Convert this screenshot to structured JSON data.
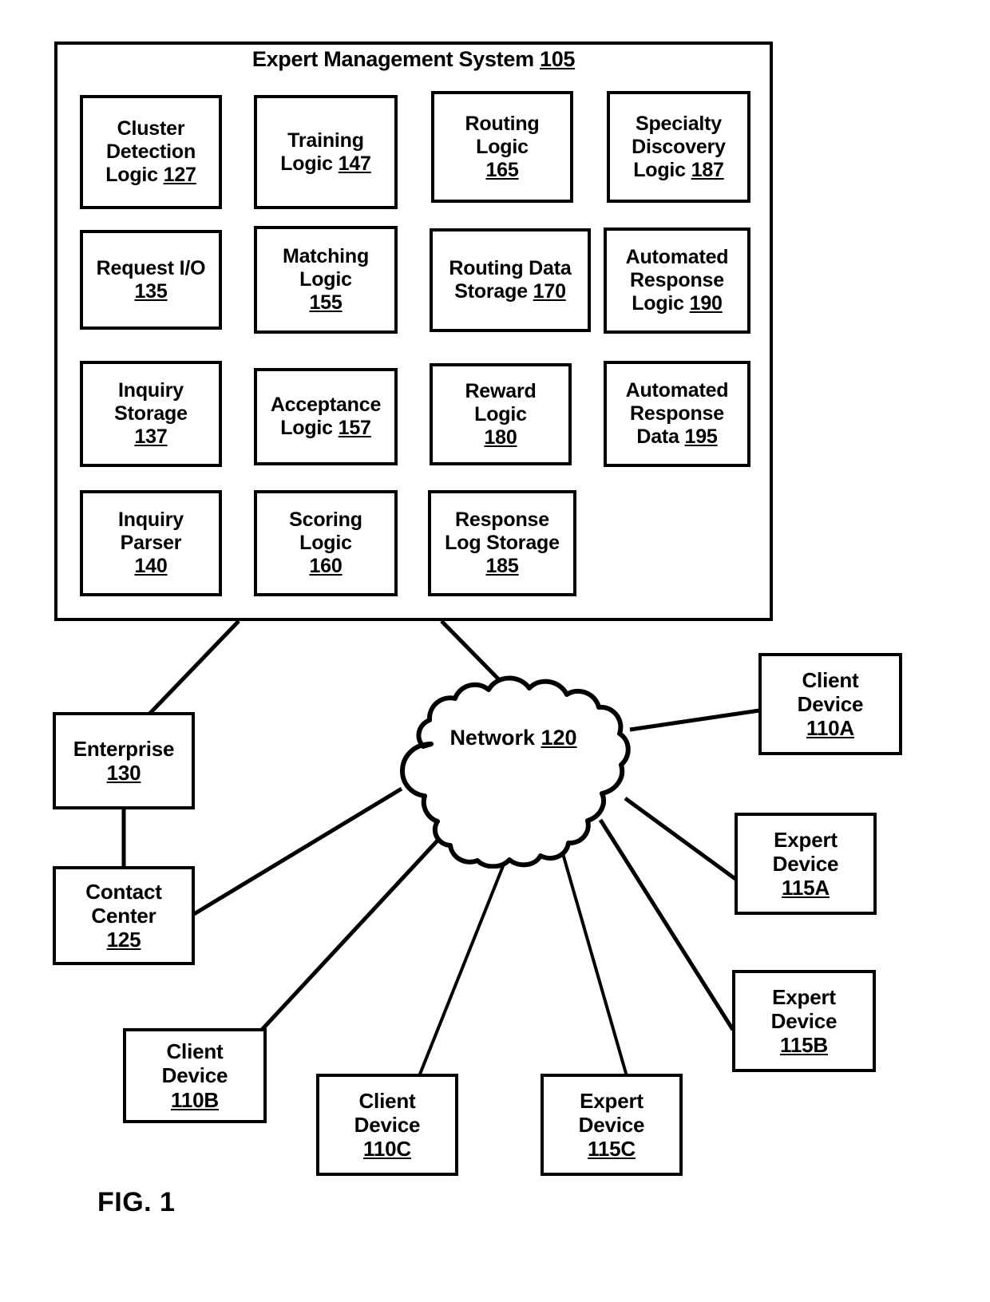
{
  "figure": {
    "caption": "FIG. 1",
    "system_title_text": "Expert Management System ",
    "system_title_num": "105"
  },
  "system": {
    "modules": [
      {
        "lines": [
          "Cluster",
          "Detection",
          "Logic "
        ],
        "num": "127",
        "num_on_line": 2
      },
      {
        "lines": [
          "Training",
          "Logic "
        ],
        "num": "147",
        "num_on_line": 1
      },
      {
        "lines": [
          "Routing",
          "Logic",
          ""
        ],
        "num": "165",
        "num_on_line": 2
      },
      {
        "lines": [
          "Specialty",
          "Discovery",
          "Logic "
        ],
        "num": "187",
        "num_on_line": 2
      },
      {
        "lines": [
          "Request I/O",
          ""
        ],
        "num": "135",
        "num_on_line": 1
      },
      {
        "lines": [
          "Matching",
          "Logic",
          ""
        ],
        "num": "155",
        "num_on_line": 2
      },
      {
        "lines": [
          "Routing Data",
          "Storage "
        ],
        "num": "170",
        "num_on_line": 1
      },
      {
        "lines": [
          "Automated",
          "Response",
          "Logic "
        ],
        "num": "190",
        "num_on_line": 2
      },
      {
        "lines": [
          "Inquiry",
          "Storage",
          ""
        ],
        "num": "137",
        "num_on_line": 2
      },
      {
        "lines": [
          "Acceptance",
          "Logic "
        ],
        "num": "157",
        "num_on_line": 1
      },
      {
        "lines": [
          "Reward",
          "Logic",
          ""
        ],
        "num": "180",
        "num_on_line": 2
      },
      {
        "lines": [
          "Automated",
          "Response",
          "Data "
        ],
        "num": "195",
        "num_on_line": 2
      },
      {
        "lines": [
          "Inquiry",
          "Parser",
          ""
        ],
        "num": "140",
        "num_on_line": 2
      },
      {
        "lines": [
          "Scoring",
          "Logic",
          ""
        ],
        "num": "160",
        "num_on_line": 2
      },
      {
        "lines": [
          "Response",
          "Log Storage",
          ""
        ],
        "num": "185",
        "num_on_line": 2
      }
    ]
  },
  "network": {
    "label": "Network",
    "num": "120"
  },
  "endpoints": [
    {
      "lines": [
        "Enterprise",
        ""
      ],
      "num": "130",
      "num_on_line": 1
    },
    {
      "lines": [
        "Contact",
        "Center",
        ""
      ],
      "num": "125",
      "num_on_line": 2
    },
    {
      "lines": [
        "Client",
        "Device",
        ""
      ],
      "num": "110A",
      "num_on_line": 2
    },
    {
      "lines": [
        "Expert",
        "Device",
        ""
      ],
      "num": "115A",
      "num_on_line": 2
    },
    {
      "lines": [
        "Expert",
        "Device",
        ""
      ],
      "num": "115B",
      "num_on_line": 2
    },
    {
      "lines": [
        "Client",
        "Device",
        ""
      ],
      "num": "110B",
      "num_on_line": 2
    },
    {
      "lines": [
        "Client",
        "Device",
        ""
      ],
      "num": "110C",
      "num_on_line": 2
    },
    {
      "lines": [
        "Expert",
        "Device",
        ""
      ],
      "num": "115C",
      "num_on_line": 2
    }
  ],
  "colors": {
    "stroke": "#000000",
    "fill": "#ffffff"
  }
}
